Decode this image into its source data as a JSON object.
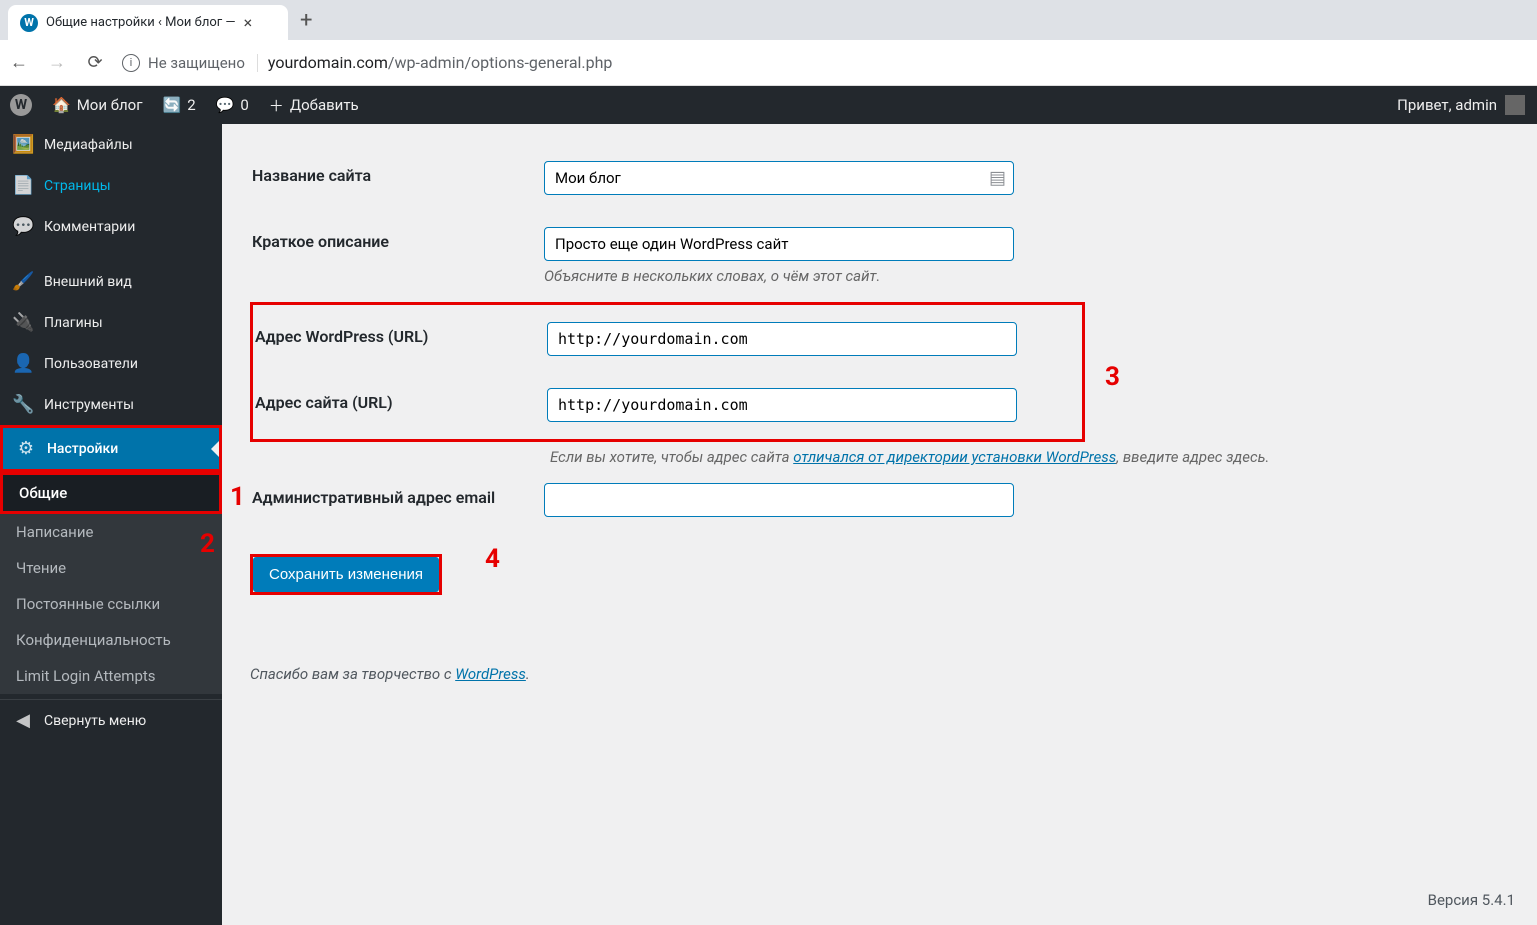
{
  "browser": {
    "tab_title": "Общие настройки ‹ Мои блог —",
    "insecure_label": "Не защищено",
    "url_domain": "yourdomain.com",
    "url_path": "/wp-admin/options-general.php"
  },
  "adminbar": {
    "site_name": "Мои блог",
    "updates_count": "2",
    "comments_count": "0",
    "add_new": "Добавить",
    "greeting": "Привет, admin"
  },
  "sidebar": {
    "media": "Медиафайлы",
    "pages": "Страницы",
    "comments": "Комментарии",
    "appearance": "Внешний вид",
    "plugins": "Плагины",
    "users": "Пользователи",
    "tools": "Инструменты",
    "settings": "Настройки",
    "submenu": {
      "general": "Общие",
      "writing": "Написание",
      "reading": "Чтение",
      "permalinks": "Постоянные ссылки",
      "privacy": "Конфиденциальность",
      "limit_login": "Limit Login Attempts"
    },
    "collapse": "Свернуть меню"
  },
  "form": {
    "site_title_label": "Название сайта",
    "site_title_value": "Мои блог",
    "tagline_label": "Краткое описание",
    "tagline_value": "Просто еще один WordPress сайт",
    "tagline_desc": "Объясните в нескольких словах, о чём этот сайт.",
    "wp_url_label": "Адрес WordPress (URL)",
    "wp_url_value": "http://yourdomain.com",
    "site_url_label": "Адрес сайта (URL)",
    "site_url_value": "http://yourdomain.com",
    "site_url_desc_part1": "Если вы хотите, чтобы адрес сайта ",
    "site_url_desc_link": "отличался от директории установки WordPress",
    "site_url_desc_part2": ", введите адрес здесь.",
    "admin_email_label": "Административный адрес email",
    "admin_email_value": "",
    "submit": "Сохранить изменения"
  },
  "footer": {
    "thanks_prefix": "Спасибо вам за творчество с ",
    "thanks_link": "WordPress",
    "version": "Версия 5.4.1"
  },
  "annotations": {
    "n1": "1",
    "n2": "2",
    "n3": "3",
    "n4": "4"
  }
}
